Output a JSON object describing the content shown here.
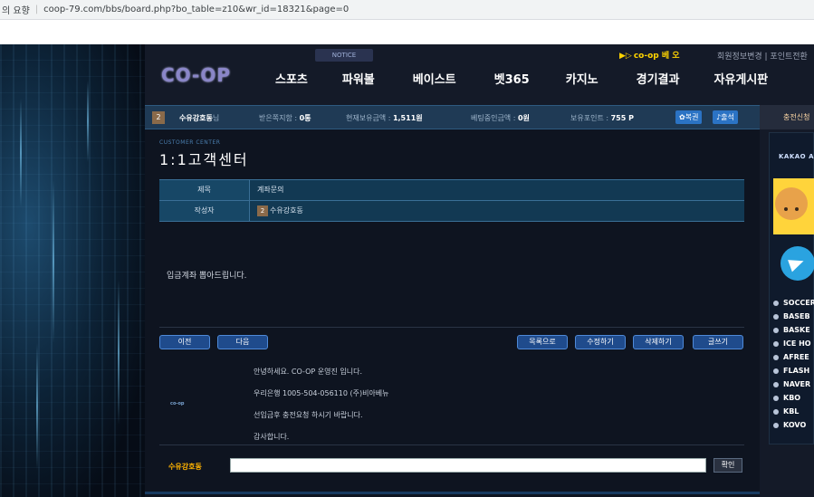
{
  "browser": {
    "tab_fragment": "의 요향",
    "url": "coop-79.com/bbs/board.php?bo_table=z10&wr_id=18321&page=0"
  },
  "header": {
    "logo": "CO-OP",
    "notice_label": "NOTICE",
    "coop_link": "co-op 베 오",
    "top_links": "회원정보변경 | 포인트전환",
    "nav": [
      "스포츠",
      "파워볼",
      "베이스트",
      "벳365",
      "카지노",
      "경기결과",
      "자유게시판"
    ]
  },
  "member": {
    "level": "2",
    "nickname": "수유강호동",
    "suffix": "님",
    "note_label": "받은쪽지함 :",
    "note_value": "0통",
    "balance_label": "현재보유금액 :",
    "balance_value": "1,511원",
    "bet_label": "베팅중인금액 :",
    "bet_value": "0원",
    "point_label": "보유포인트 :",
    "point_value": "755 P",
    "attendance_btn": "복권",
    "checkin_btn": "출석"
  },
  "sidebar": {
    "top_label": "충전신청",
    "kakao_label": "KAKAO A",
    "sports": [
      "SOCCER",
      "BASEB",
      "BASKE",
      "ICE HO",
      "AFREE",
      "FLASH",
      "NAVER",
      "KBO",
      "KBL",
      "KOVO"
    ]
  },
  "page": {
    "small_title": "CUSTOMER CENTER",
    "title": "1:1고객센터",
    "subject_label": "제목",
    "subject_value": "계좌문의",
    "author_label": "작성자",
    "author_level": "2",
    "author_value": "수유강호동",
    "content": "입금계좌 뽑아드립니다.",
    "buttons": {
      "prev": "이전",
      "next": "다음",
      "list": "목록으로",
      "edit": "수정하기",
      "delete": "삭제하기",
      "write": "글쓰기"
    },
    "signature": {
      "logo": "co-op",
      "line1": "안녕하세요. CO-OP 운영진 입니다.",
      "line2": "우리은행 1005-504-056110 (주)비아베뉴",
      "line3": "선입금후 충전요청 하시기 바랍니다.",
      "line4": "감사합니다."
    },
    "comment": {
      "author": "수유강호동",
      "input_value": "",
      "confirm": "확인"
    }
  }
}
